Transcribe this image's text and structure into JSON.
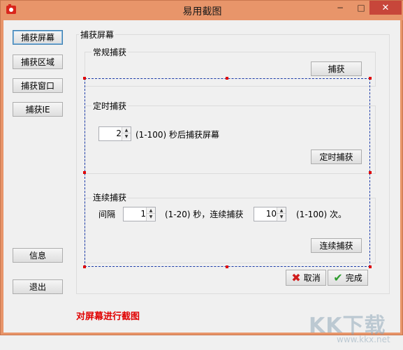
{
  "window": {
    "title": "易用截图",
    "controls": {
      "minimize": "−",
      "maximize": "□",
      "close": "✕"
    }
  },
  "sidebar": {
    "items": [
      {
        "label": "捕获屏幕",
        "selected": true
      },
      {
        "label": "捕获区域"
      },
      {
        "label": "捕获窗口"
      },
      {
        "label": "捕获IE"
      }
    ],
    "info_label": "信息",
    "exit_label": "退出"
  },
  "main": {
    "title": "捕获屏幕",
    "regular": {
      "title": "常规捕获",
      "button": "捕获"
    },
    "timed": {
      "title": "定时捕获",
      "seconds_value": "2",
      "hint": "(1-100) 秒后捕获屏幕",
      "button": "定时捕获"
    },
    "continuous": {
      "title": "连续捕获",
      "interval_label": "间隔",
      "interval_value": "1",
      "interval_hint": "(1-20) 秒，连续捕获",
      "count_value": "10",
      "count_hint": "(1-100) 次。",
      "button": "连续捕获"
    }
  },
  "actions": {
    "cancel": "取消",
    "done": "完成"
  },
  "status": "对屏幕进行截图",
  "watermark": {
    "big": "KK下载",
    "small": "www.kkx.net"
  },
  "colors": {
    "titlebar": "#e8956a",
    "close_button": "#c7463a",
    "status_text": "#e00000",
    "selection_border": "#1a3aa8"
  }
}
